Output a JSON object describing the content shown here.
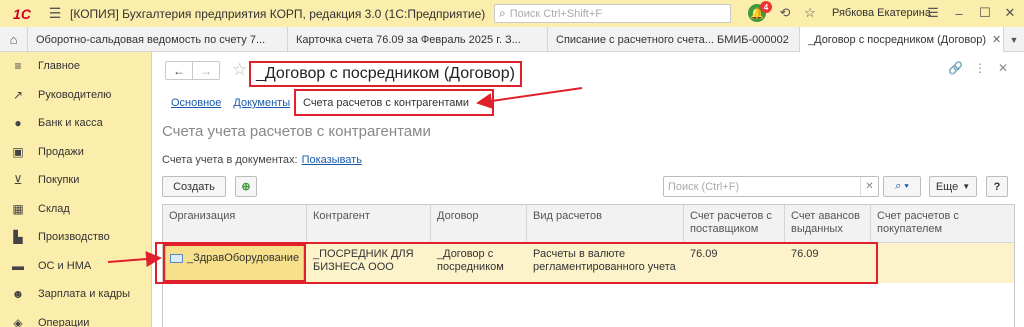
{
  "titlebar": {
    "logo": "1С",
    "title": "[КОПИЯ] Бухгалтерия предприятия КОРП, редакция 3.0  (1С:Предприятие)",
    "search_placeholder": "Поиск Ctrl+Shift+F",
    "notifications_count": "4",
    "user": "Рябкова Екатерина"
  },
  "tabs": [
    {
      "label": "Оборотно-сальдовая ведомость по счету 7..."
    },
    {
      "label": "Карточка счета 76.09 за Февраль 2025 г. З..."
    },
    {
      "label": "Списание с расчетного счета... БМИБ-000002"
    },
    {
      "label": "_Договор с посредником (Договор)"
    }
  ],
  "sidebar": {
    "items": [
      {
        "label": "Главное",
        "icon": "menu-icon"
      },
      {
        "label": "Руководителю",
        "icon": "chart-line-icon"
      },
      {
        "label": "Банк и касса",
        "icon": "coin-icon"
      },
      {
        "label": "Продажи",
        "icon": "bag-icon"
      },
      {
        "label": "Покупки",
        "icon": "cart-icon"
      },
      {
        "label": "Склад",
        "icon": "grid-icon"
      },
      {
        "label": "Производство",
        "icon": "factory-icon"
      },
      {
        "label": "ОС и НМА",
        "icon": "truck-icon"
      },
      {
        "label": "Зарплата и кадры",
        "icon": "people-icon"
      },
      {
        "label": "Операции",
        "icon": "ops-icon"
      }
    ]
  },
  "form": {
    "title": "_Договор с посредником (Договор)",
    "subnav": {
      "main": "Основное",
      "docs": "Документы",
      "current": "Счета расчетов с контрагентами"
    },
    "section_title": "Счета учета расчетов с контрагентами",
    "accounts_in_docs_label": "Счета учета в документах:",
    "accounts_in_docs_link": "Показывать",
    "create_button": "Создать",
    "search_placeholder": "Поиск (Ctrl+F)",
    "more_button": "Еще",
    "help_button": "?"
  },
  "table": {
    "columns": [
      "Организация",
      "Контрагент",
      "Договор",
      "Вид расчетов",
      "Счет расчетов с поставщиком",
      "Счет авансов выданных",
      "Счет расчетов с покупателем"
    ],
    "rows": [
      {
        "org": "_ЗдравОборудование",
        "counterparty": "_ПОСРЕДНИК ДЛЯ БИЗНЕСА ООО",
        "contract": "_Договор с посредником",
        "settlement_type": "Расчеты в валюте регламентированного учета",
        "supplier_account": "76.09",
        "advance_account": "76.09",
        "buyer_account": ""
      }
    ]
  },
  "colors": {
    "accent_red": "#e0202a",
    "sidebar_bg": "#fbedab",
    "link_blue": "#1a5aa8"
  }
}
